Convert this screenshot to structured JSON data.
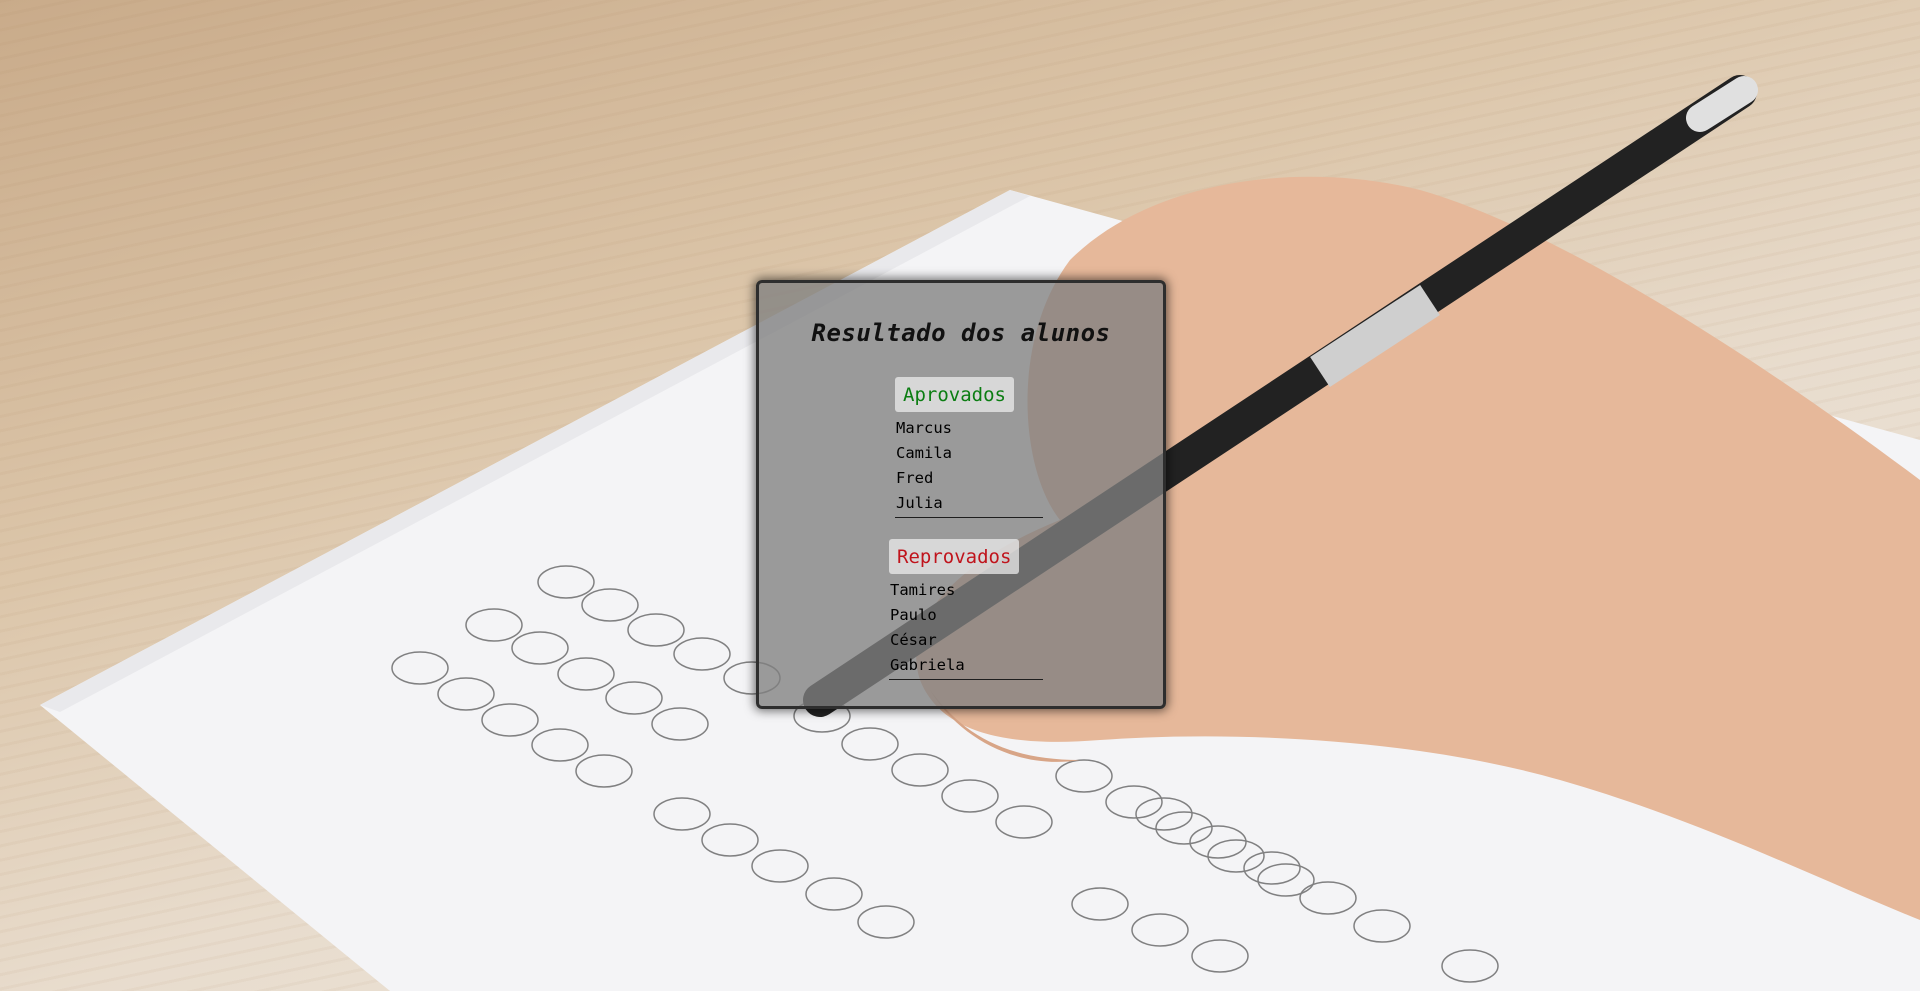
{
  "panel": {
    "title": "Resultado dos alunos",
    "approved": {
      "label": "Aprovados",
      "color": "#0b7d12",
      "names": [
        "Marcus",
        "Camila",
        "Fred",
        "Julia"
      ]
    },
    "failed": {
      "label": "Reprovados",
      "color": "#c0141c",
      "names": [
        "Tamires",
        "Paulo",
        "César",
        "Gabriela"
      ]
    }
  }
}
